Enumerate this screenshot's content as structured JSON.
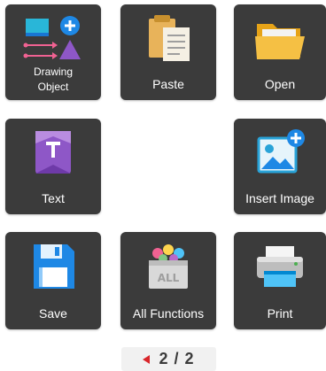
{
  "tiles": {
    "drawing_object": {
      "label_line1": "Drawing",
      "label_line2": "Object",
      "icon": "shapes-icon"
    },
    "paste": {
      "label": "Paste",
      "icon": "clipboard-icon"
    },
    "open": {
      "label": "Open",
      "icon": "folder-icon"
    },
    "text": {
      "label": "Text",
      "icon": "text-box-icon"
    },
    "insert_image": {
      "label": "Insert Image",
      "icon": "picture-add-icon"
    },
    "save": {
      "label": "Save",
      "icon": "floppy-disk-icon"
    },
    "all_functions": {
      "label": "All Functions",
      "icon": "functions-box-icon"
    },
    "print": {
      "label": "Print",
      "icon": "printer-icon"
    }
  },
  "pager": {
    "text": "2 / 2",
    "icon": "prev-page-arrow-icon"
  },
  "colors": {
    "tile_bg": "#3b3b3b",
    "accent_blue": "#1e88e5",
    "accent_purple": "#8e57c7",
    "arrow_red": "#d9262b"
  }
}
